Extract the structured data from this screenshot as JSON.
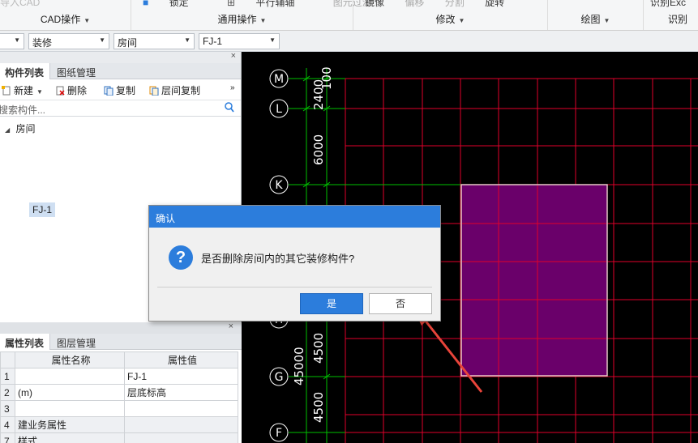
{
  "ribbon": {
    "top_items": [
      "导入CAD",
      "锁定",
      "平行辅轴",
      "图元过滤",
      "镜像",
      "偏移",
      "分割",
      "旋转",
      "识别Exc"
    ],
    "groups": [
      "CAD操作",
      "通用操作",
      "修改",
      "绘图",
      "识别"
    ]
  },
  "dropdowns": [
    "",
    "装修",
    "房间",
    "FJ-1"
  ],
  "component_panel": {
    "tabs": [
      "构件列表",
      "图纸管理"
    ],
    "toolbar": {
      "new": "新建",
      "delete": "删除",
      "copy": "复制",
      "floor_copy": "层间复制",
      "more": "»"
    },
    "search_placeholder": "搜索构件...",
    "tree": {
      "root": "房间",
      "child": "FJ-1"
    },
    "close": "×"
  },
  "property_panel": {
    "tabs": [
      "属性列表",
      "图层管理"
    ],
    "headers": [
      "属性名称",
      "属性值"
    ],
    "rows": [
      {
        "num": "1",
        "name": "",
        "value": "FJ-1"
      },
      {
        "num": "2",
        "name": "(m)",
        "value": "层底标高"
      },
      {
        "num": "3",
        "name": "",
        "value": ""
      },
      {
        "num": "4",
        "name": "建业务属性",
        "value": ""
      },
      {
        "num": "7",
        "name": "样式",
        "value": ""
      }
    ],
    "close": "×"
  },
  "cad": {
    "axis_labels": [
      "M",
      "L",
      "K",
      "H",
      "G",
      "F"
    ],
    "dimensions": [
      "100",
      "2400",
      "6000",
      "45000",
      "4500",
      "4500"
    ],
    "colors": {
      "grid": "#e0002a",
      "axis": "#00c000",
      "room_fill": "#6a006a",
      "room_edge": "#e8c8c8"
    }
  },
  "dialog": {
    "title": "确认",
    "message": "是否删除房间内的其它装修构件?",
    "yes": "是",
    "no": "否",
    "icon": "?"
  }
}
